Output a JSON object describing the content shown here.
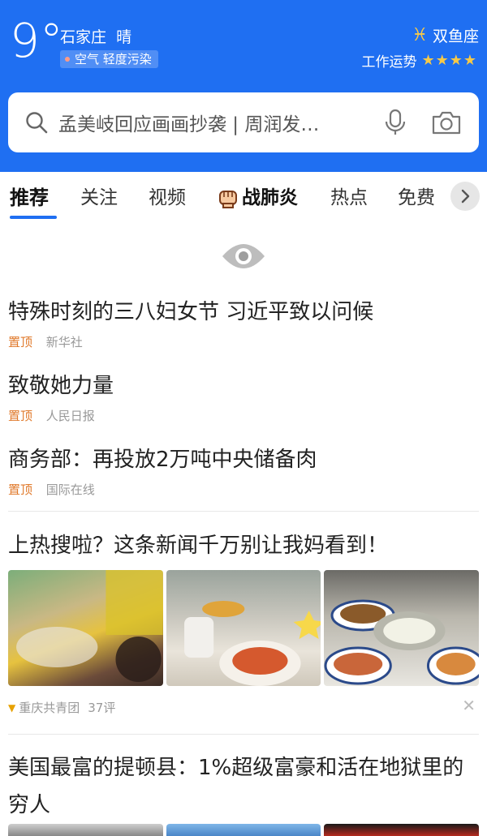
{
  "weather": {
    "temperature": "9°",
    "city": "石家庄",
    "condition": "晴",
    "air_quality": "空气 轻度污染"
  },
  "horoscope": {
    "sign": "双鱼座",
    "sign_symbol": "♓",
    "fortune_label": "工作运势",
    "fortune_stars": "★★★★"
  },
  "search": {
    "placeholder": "孟美岐回应画画抄袭 | 周润发…"
  },
  "tabs": {
    "items": [
      "推荐",
      "关注",
      "视频",
      "战肺炎",
      "热点",
      "免费"
    ],
    "active": "推荐"
  },
  "pinned": [
    {
      "title": "特殊时刻的三八妇女节 习近平致以问候",
      "tag": "置顶",
      "source": "新华社"
    },
    {
      "title": "致敬她力量",
      "tag": "置顶",
      "source": "人民日报"
    },
    {
      "title": "商务部：再投放2万吨中央储备肉",
      "tag": "置顶",
      "source": "国际在线"
    }
  ],
  "news": [
    {
      "title": "上热搜啦？这条新闻千万别让我妈看到！",
      "source": "重庆共青团",
      "comments": "37评"
    },
    {
      "title": "美国最富的提顿县：1%超级富豪和活在地狱里的穷人"
    }
  ],
  "colors": {
    "brand_blue": "#1f6ff2",
    "tag_orange": "#e07a2c",
    "star_yellow": "#f7c948"
  }
}
